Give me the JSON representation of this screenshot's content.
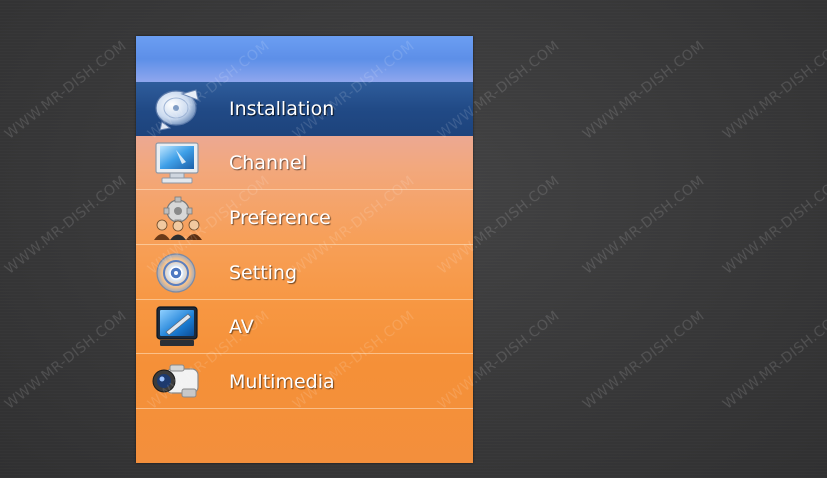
{
  "menu": {
    "selected_index": 0,
    "items": [
      {
        "label": "Installation",
        "icon": "satellite-dish-icon",
        "selected": true
      },
      {
        "label": "Channel",
        "icon": "tv-monitor-icon",
        "selected": false
      },
      {
        "label": "Preference",
        "icon": "people-gear-icon",
        "selected": false
      },
      {
        "label": "Setting",
        "icon": "settings-disc-icon",
        "selected": false
      },
      {
        "label": "AV",
        "icon": "av-screen-icon",
        "selected": false
      },
      {
        "label": "Multimedia",
        "icon": "camcorder-icon",
        "selected": false
      }
    ]
  },
  "watermark": {
    "text": "WWW.MR-DISH.COM"
  },
  "colors": {
    "background": "#3b3b3c",
    "header_blue": "#6b9ef2",
    "selected_bar": "#214a86",
    "panel_orange": "#f79742",
    "panel_pink": "#e6a9a6"
  }
}
